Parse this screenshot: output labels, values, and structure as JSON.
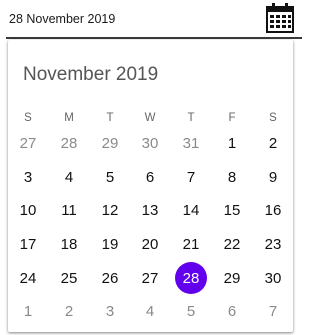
{
  "field": {
    "value": "28 November 2019"
  },
  "calendar": {
    "title": "November 2019",
    "weekdays": [
      "S",
      "M",
      "T",
      "W",
      "T",
      "F",
      "S"
    ],
    "weeks": [
      [
        {
          "d": "27",
          "m": true
        },
        {
          "d": "28",
          "m": true
        },
        {
          "d": "29",
          "m": true
        },
        {
          "d": "30",
          "m": true
        },
        {
          "d": "31",
          "m": true
        },
        {
          "d": "1"
        },
        {
          "d": "2"
        }
      ],
      [
        {
          "d": "3"
        },
        {
          "d": "4"
        },
        {
          "d": "5"
        },
        {
          "d": "6"
        },
        {
          "d": "7"
        },
        {
          "d": "8"
        },
        {
          "d": "9"
        }
      ],
      [
        {
          "d": "10"
        },
        {
          "d": "11"
        },
        {
          "d": "12"
        },
        {
          "d": "13"
        },
        {
          "d": "14"
        },
        {
          "d": "15"
        },
        {
          "d": "16"
        }
      ],
      [
        {
          "d": "17"
        },
        {
          "d": "18"
        },
        {
          "d": "19"
        },
        {
          "d": "20"
        },
        {
          "d": "21"
        },
        {
          "d": "22"
        },
        {
          "d": "23"
        }
      ],
      [
        {
          "d": "24"
        },
        {
          "d": "25"
        },
        {
          "d": "26"
        },
        {
          "d": "27"
        },
        {
          "d": "28",
          "selected": true
        },
        {
          "d": "29"
        },
        {
          "d": "30"
        }
      ],
      [
        {
          "d": "1",
          "m": true
        },
        {
          "d": "2",
          "m": true
        },
        {
          "d": "3",
          "m": true
        },
        {
          "d": "4",
          "m": true
        },
        {
          "d": "5",
          "m": true
        },
        {
          "d": "6",
          "m": true
        },
        {
          "d": "7",
          "m": true
        }
      ]
    ],
    "accent_color": "#6200ee",
    "icon": "calendar-icon"
  }
}
